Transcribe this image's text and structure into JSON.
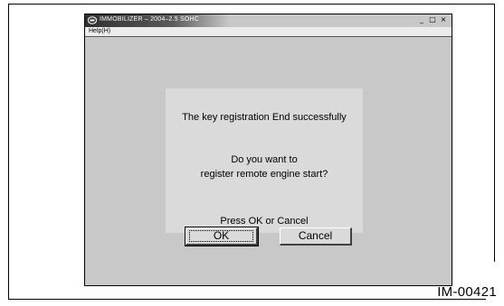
{
  "window": {
    "title": "IMMOBILIZER – 2004–2.5 SOHC",
    "controls": {
      "minimize": "_",
      "maximize": "□",
      "close": "×"
    }
  },
  "menubar": {
    "items": [
      {
        "label": "Help(H)"
      }
    ]
  },
  "dialog": {
    "line1": "The key registration End successfully",
    "line2": "Do you want to",
    "line3": "register remote engine start?",
    "line4": "Press OK or Cancel",
    "ok_label": "OK",
    "cancel_label": "Cancel"
  },
  "figure": {
    "code": "IM-00421"
  },
  "icons": {
    "app": "car-icon"
  },
  "colors": {
    "titlebar_dark": "#303030",
    "window_bg": "#c8c8c8",
    "panel_bg": "#dadada"
  }
}
